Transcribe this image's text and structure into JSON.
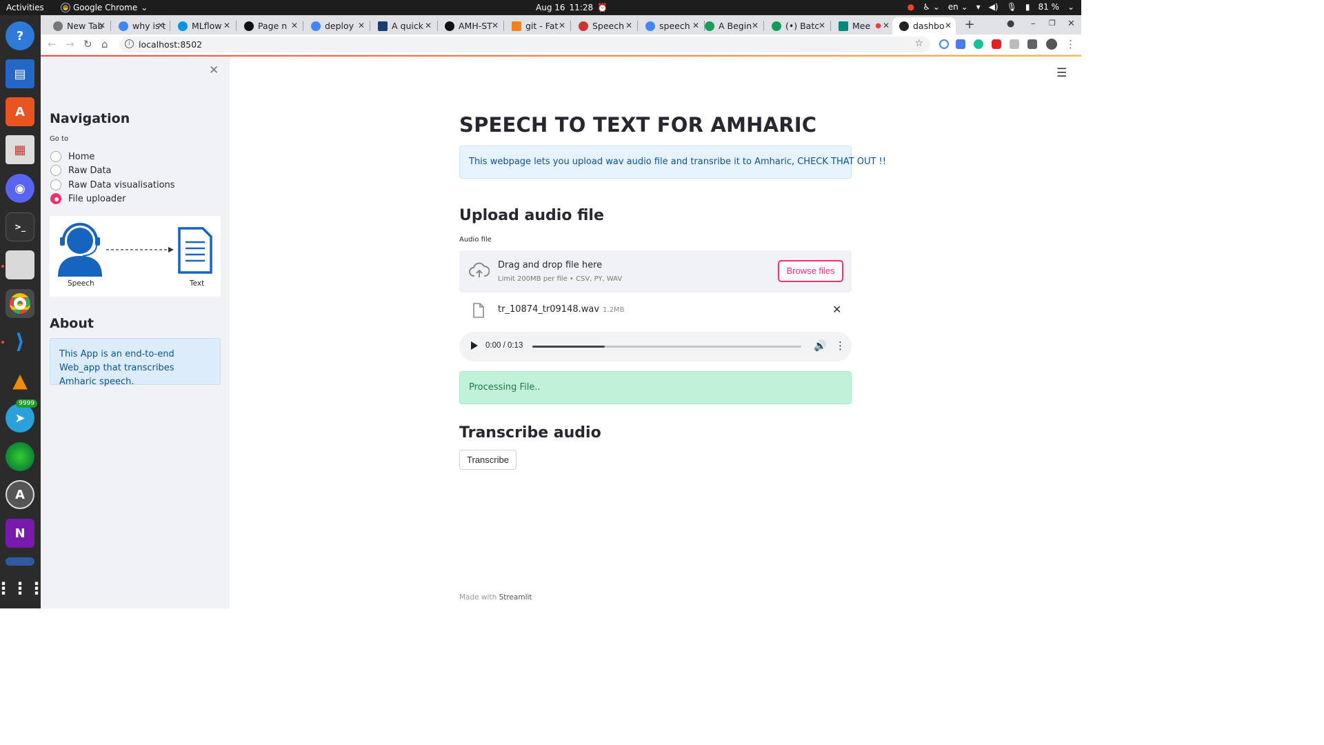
{
  "os": {
    "activities": "Activities",
    "app_name": "Google Chrome",
    "date": "Aug 16",
    "time": "11:28",
    "lang": "en",
    "battery": "81 %"
  },
  "dock": {
    "telegram_badge": "9999"
  },
  "browser": {
    "tabs": [
      {
        "label": "New Tab"
      },
      {
        "label": "why is t"
      },
      {
        "label": "MLflow"
      },
      {
        "label": "Page n"
      },
      {
        "label": "deploy"
      },
      {
        "label": "A quick"
      },
      {
        "label": "AMH-ST"
      },
      {
        "label": "git - Fat"
      },
      {
        "label": "Speech"
      },
      {
        "label": "speech"
      },
      {
        "label": "A Begin"
      },
      {
        "label": "(•) Batc"
      },
      {
        "label": "Mee"
      },
      {
        "label": "dashbo"
      }
    ],
    "url": "localhost:8502"
  },
  "sidebar": {
    "nav_heading": "Navigation",
    "goto_label": "Go to",
    "options": [
      "Home",
      "Raw Data",
      "Raw Data visualisations",
      "File uploader"
    ],
    "selected_option": "File uploader",
    "illustration": {
      "speech_caption": "Speech",
      "text_caption": "Text"
    },
    "about_heading": "About",
    "about_text": "This App is an end-to-end Web_app that transcribes Amharic speech."
  },
  "main": {
    "title": "SPEECH TO TEXT FOR AMHARIC",
    "info_text": "This webpage lets you upload wav audio file and transribe it to Amharic, CHECK THAT OUT !!",
    "upload_heading": "Upload audio file",
    "upload_label": "Audio file",
    "dropzone_title": "Drag and drop file here",
    "dropzone_limit": "Limit 200MB per file • CSV, PY, WAV",
    "browse_label": "Browse files",
    "file_name": "tr_10874_tr09148.wav",
    "file_size": "1.2MB",
    "player": {
      "time": "0:00 / 0:13",
      "buffered_fraction": 0.27
    },
    "success_text": "Processing File..",
    "transcribe_heading": "Transcribe audio",
    "transcribe_button": "Transcribe",
    "footer_prefix": "Made with",
    "footer_brand": "Streamlit"
  },
  "colors": {
    "accent": "#ff2b6b",
    "info_bg": "#e6f3fc",
    "success_bg": "#c1f2d9",
    "sidebar_bg": "#f0f2f6"
  }
}
